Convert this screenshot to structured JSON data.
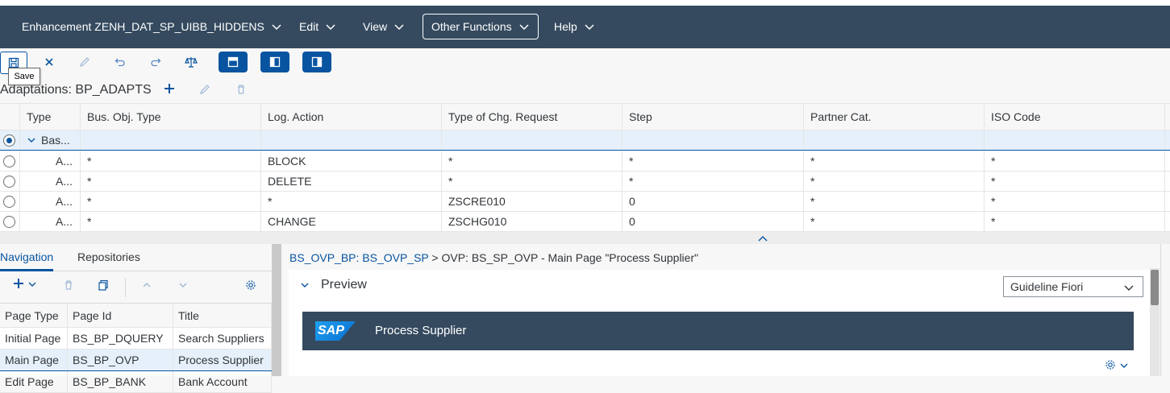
{
  "menubar": {
    "items": [
      {
        "label": "Enhancement ZENH_DAT_SP_UIBB_HIDDENS"
      },
      {
        "label": "Edit"
      },
      {
        "label": "View"
      },
      {
        "label": "Other Functions"
      },
      {
        "label": "Help"
      }
    ]
  },
  "toolbar": {
    "save_tooltip": "Save",
    "adaptations_title": "Adaptations: BP_ADAPTS"
  },
  "grid": {
    "columns": [
      "Type",
      "Bus. Obj. Type",
      "Log. Action",
      "Type of Chg. Request",
      "Step",
      "Partner Cat.",
      "ISO Code"
    ],
    "group_row": {
      "label": "Bas..."
    },
    "rows": [
      {
        "type": "A...",
        "bus_obj": "*",
        "log_action": "BLOCK",
        "chg_req": "*",
        "step": "*",
        "partner": "*",
        "iso": "*"
      },
      {
        "type": "A...",
        "bus_obj": "*",
        "log_action": "DELETE",
        "chg_req": "*",
        "step": "*",
        "partner": "*",
        "iso": "*"
      },
      {
        "type": "A...",
        "bus_obj": "*",
        "log_action": "*",
        "chg_req": "ZSCRE010",
        "step": "0",
        "partner": "*",
        "iso": "*"
      },
      {
        "type": "A...",
        "bus_obj": "*",
        "log_action": "CHANGE",
        "chg_req": "ZSCHG010",
        "step": "0",
        "partner": "*",
        "iso": "*"
      }
    ]
  },
  "left": {
    "tabs": [
      "Navigation",
      "Repositories"
    ],
    "columns": [
      "Page Type",
      "Page Id",
      "Title"
    ],
    "rows": [
      {
        "type": "Initial Page",
        "id": "BS_BP_DQUERY",
        "title": "Search Suppliers"
      },
      {
        "type": "Main Page",
        "id": "BS_BP_OVP",
        "title": "Process Supplier"
      },
      {
        "type": "Edit Page",
        "id": "BS_BP_BANK",
        "title": "Bank Account"
      }
    ]
  },
  "right": {
    "crumb_link": "BS_OVP_BP: BS_OVP_SP",
    "crumb_rest": " > OVP: BS_SP_OVP - Main Page \"Process Supplier\"",
    "preview_label": "Preview",
    "guideline": "Guideline Fiori",
    "shell_logo": "SAP",
    "shell_title": "Process Supplier"
  }
}
